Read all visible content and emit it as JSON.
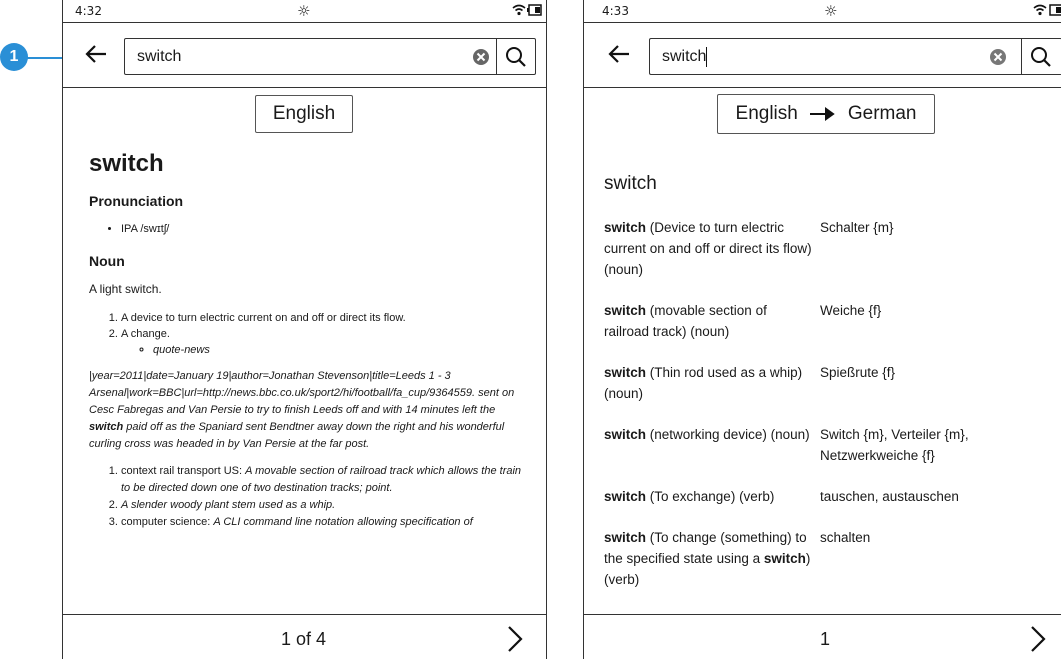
{
  "left": {
    "status": {
      "time": "4:32"
    },
    "search": {
      "query": "switch"
    },
    "language_button": "English",
    "article": {
      "title": "switch",
      "pronunciation_heading": "Pronunciation",
      "ipa": "IPA /swɪtʃ/",
      "noun_heading": "Noun",
      "intro": "A light switch.",
      "senses": [
        "A device to turn electric current on and off or direct its flow.",
        "A change."
      ],
      "sub": "quote-news",
      "quote_before": "|year=2011|date=January 19|author=Jonathan Stevenson|title=Leeds 1 - 3 Arsenal|work=BBC|url=http://news.bbc.co.uk/sport2/hi/football/fa_cup/9364559. sent on Cesc Fabregas and Van Persie to try to finish Leeds off and with 14 minutes left the ",
      "quote_bold": "switch",
      "quote_after": " paid off as the Spaniard sent Bendtner away down the right and his wonderful curling cross was headed in by Van Persie at the far post.",
      "list2": [
        {
          "prefix": "context rail transport US: ",
          "text": "A movable section of railroad track which allows the train to be directed down one of two destination tracks; point."
        },
        {
          "prefix": "",
          "text": "A slender woody plant stem used as a whip."
        },
        {
          "prefix": "computer science: ",
          "text": "A CLI command line notation allowing specification of"
        }
      ]
    },
    "footer": {
      "page": "1 of 4"
    }
  },
  "right": {
    "status": {
      "time": "4:33"
    },
    "search": {
      "query": "switch"
    },
    "language_from": "English",
    "language_to": "German",
    "word": "switch",
    "rows": [
      {
        "bold": "switch",
        "desc": " (Device to turn electric current on and off or direct its flow) (noun)",
        "translation": "Schalter {m}"
      },
      {
        "bold": "switch",
        "desc": " (movable section of railroad track) (noun)",
        "translation": "Weiche {f}"
      },
      {
        "bold": "switch",
        "desc": " (Thin rod used as a whip) (noun)",
        "translation": "Spießrute {f}"
      },
      {
        "bold": "switch",
        "desc": " (networking device) (noun)",
        "translation": "Switch {m}, Verteiler {m}, Netzwerkweiche {f}"
      },
      {
        "bold": "switch",
        "desc": " (To exchange) (verb)",
        "translation": "tauschen, austauschen"
      },
      {
        "bold": "switch",
        "desc": " (To change (something) to the specified state using a ",
        "bold2": "switch",
        "desc2": ") (verb)",
        "translation": "schalten"
      }
    ],
    "footer": {
      "page": "1"
    }
  },
  "callout": {
    "number": "1",
    "color": "#2a8fd6"
  }
}
